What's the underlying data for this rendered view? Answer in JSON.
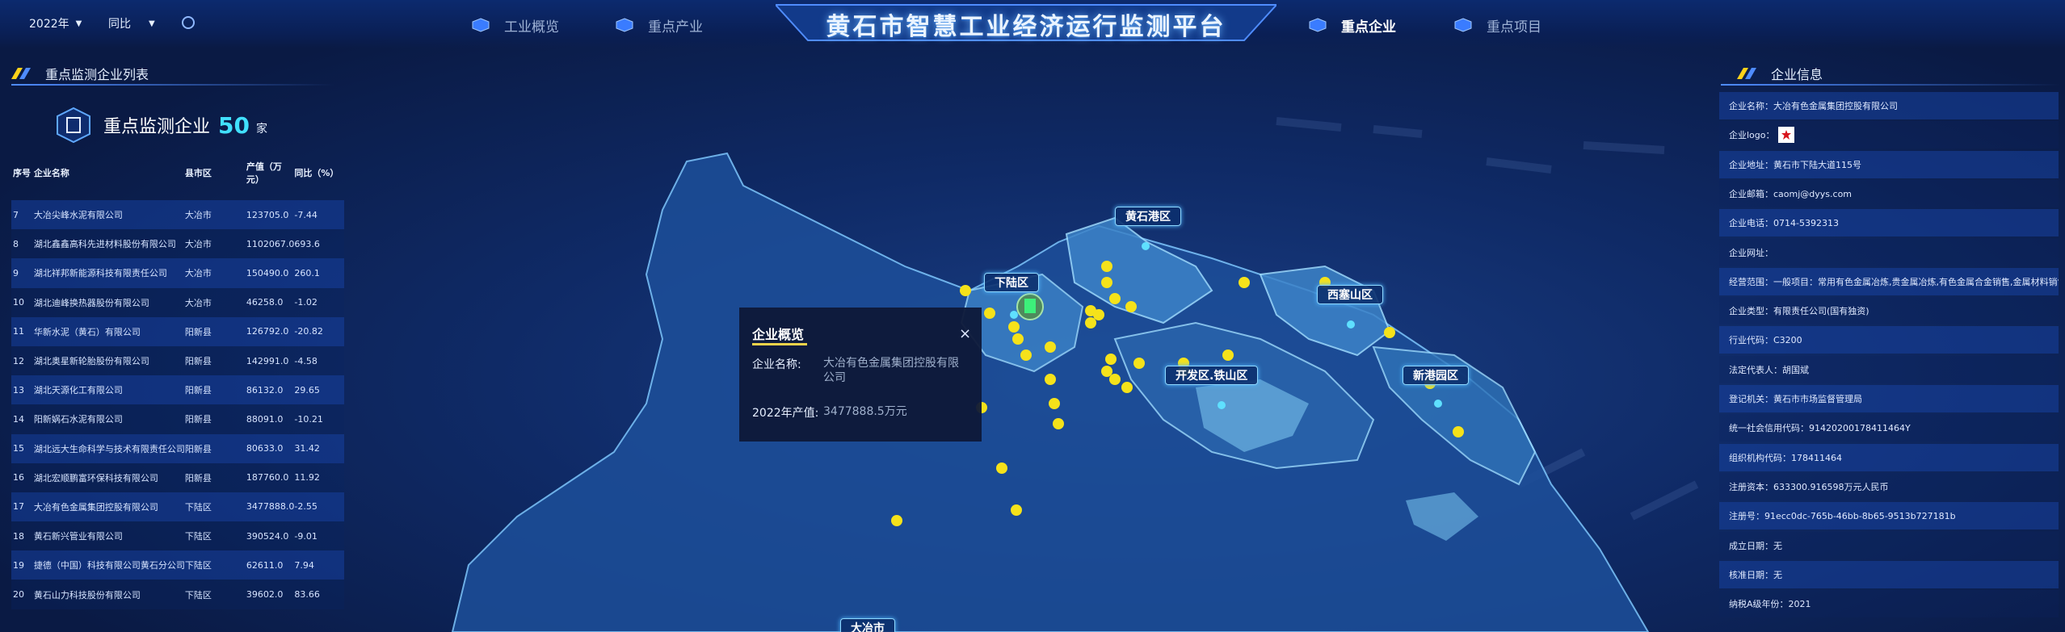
{
  "header": {
    "title": "黄石市智慧工业经济运行监测平台",
    "year_select": "2022年",
    "compare_select": "同比",
    "nav": [
      {
        "label": "工业概览",
        "active": false
      },
      {
        "label": "重点产业",
        "active": false
      },
      {
        "label": "重点企业",
        "active": true
      },
      {
        "label": "重点项目",
        "active": false
      }
    ]
  },
  "left_panel": {
    "title": "重点监测企业列表",
    "count_label": "重点监测企业",
    "count_value": "50",
    "count_unit": "家",
    "columns": [
      "序号",
      "企业名称",
      "县市区",
      "产值（万元）",
      "同比（%）"
    ],
    "rows": [
      [
        "7",
        "大冶尖峰水泥有限公司",
        "大冶市",
        "123705.0",
        "-7.44"
      ],
      [
        "8",
        "湖北鑫鑫高科先进材料股份有限公司",
        "大冶市",
        "1102067.0",
        "693.6"
      ],
      [
        "9",
        "湖北祥邦新能源科技有限责任公司",
        "大冶市",
        "150490.0",
        "260.1"
      ],
      [
        "10",
        "湖北迪峰换热器股份有限公司",
        "大冶市",
        "46258.0",
        "-1.02"
      ],
      [
        "11",
        "华新水泥（黄石）有限公司",
        "阳新县",
        "126792.0",
        "-20.82"
      ],
      [
        "12",
        "湖北奥星新轮胎股份有限公司",
        "阳新县",
        "142991.0",
        "-4.58"
      ],
      [
        "13",
        "湖北天源化工有限公司",
        "阳新县",
        "86132.0",
        "29.65"
      ],
      [
        "14",
        "阳新娲石水泥有限公司",
        "阳新县",
        "88091.0",
        "-10.21"
      ],
      [
        "15",
        "湖北远大生命科学与技术有限责任公司",
        "阳新县",
        "80633.0",
        "31.42"
      ],
      [
        "16",
        "湖北宏顺鹏富环保科技有限公司",
        "阳新县",
        "187760.0",
        "11.92"
      ],
      [
        "17",
        "大冶有色金属集团控股有限公司",
        "下陆区",
        "3477888.0",
        "-2.55"
      ],
      [
        "18",
        "黄石新兴管业有限公司",
        "下陆区",
        "390524.0",
        "-9.01"
      ],
      [
        "19",
        "捷德（中国）科技有限公司黄石分公司",
        "下陆区",
        "62611.0",
        "7.94"
      ],
      [
        "20",
        "黄石山力科技股份有限公司",
        "下陆区",
        "39602.0",
        "83.66"
      ]
    ]
  },
  "right_panel": {
    "title": "企业信息",
    "items": [
      "企业名称：大冶有色金属集团控股有限公司",
      "企业logo：",
      "企业地址：黄石市下陆大道115号",
      "企业邮箱：caomj@dyys.com",
      "企业电话：0714-5392313",
      "企业网址：",
      "经营范围：一般项目：常用有色金属冶炼,贵金属冶炼,有色金属合金销售,金属材料销售,金",
      "企业类型：有限责任公司(国有独资)",
      "行业代码：C3200",
      "法定代表人：胡国斌",
      "登记机关：黄石市市场监督管理局",
      "统一社会信用代码：91420200178411464Y",
      "组织机构代码：178411464",
      "注册资本：633300.916598万元人民币",
      "注册号：91ecc0dc-765b-46bb-8b65-9513b727181b",
      "成立日期：无",
      "核准日期：无",
      "纳税A级年份：2021"
    ]
  },
  "map": {
    "districts": [
      "黄石港区",
      "下陆区",
      "西塞山区",
      "开发区.铁山区",
      "新港园区",
      "大冶市"
    ],
    "accent": "#f5e21a"
  },
  "popup": {
    "title": "企业概览",
    "close": "×",
    "name_label": "企业名称:",
    "name_value": "大冶有色金属集团控股有限公司",
    "output_label": "2022年产值:",
    "output_value": "3477888.5万元"
  }
}
